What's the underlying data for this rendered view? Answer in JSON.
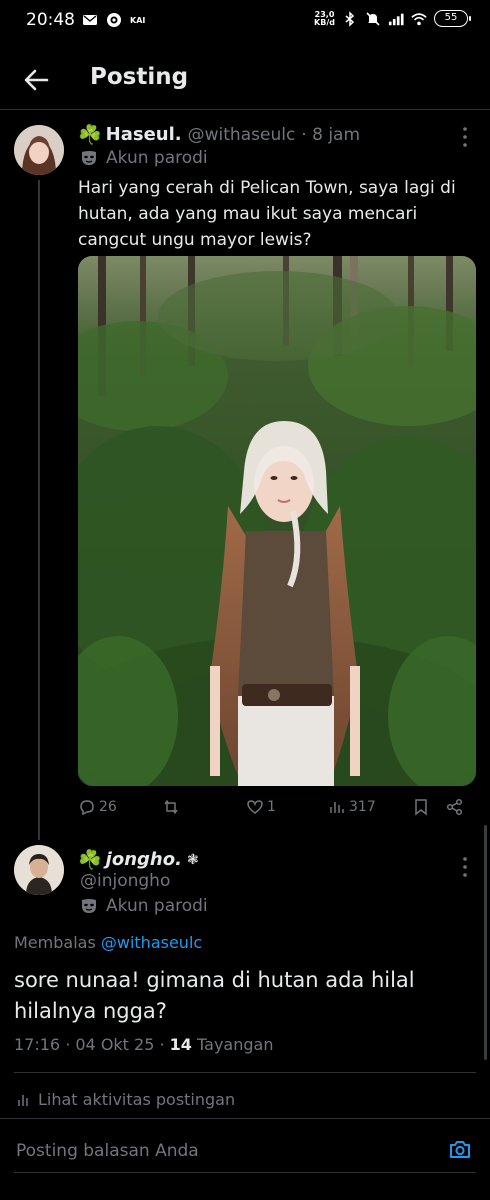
{
  "status_bar": {
    "time": "20:48",
    "kai": "KAI",
    "net_speed_value": "23,0",
    "net_speed_unit": "KB/d",
    "battery": "55",
    "icons": [
      "mail-icon",
      "circle-app-icon",
      "bluetooth-icon",
      "mute-icon",
      "signal-icon",
      "wifi-icon"
    ]
  },
  "header": {
    "title": "Posting",
    "back_icon": "arrow-left-icon"
  },
  "tweet": {
    "badge": "☘️",
    "name": "Haseul.",
    "handle": "@withaseulc",
    "time": "· 8 jam",
    "parody_label": "Akun parodi",
    "text": "Hari yang cerah di Pelican Town, saya lagi di hutan, ada yang mau ikut saya mencari cangcut ungu mayor lewis?",
    "actions": {
      "replies": "26",
      "retweets": "",
      "likes": "1",
      "views": "317"
    }
  },
  "reply": {
    "badge": "☘️",
    "name": "jongho.",
    "name_suffix": "❃",
    "handle": "@injongho",
    "parody_label": "Akun parodi",
    "replying_prefix": "Membalas",
    "replying_to": "@withaseulc",
    "text": "sore nunaa! gimana di hutan ada hilal hilalnya ngga?",
    "timestamp": "17:16 · 04 Okt 25 · ",
    "views_count": "14",
    "views_label": " Tayangan"
  },
  "activity_label": "Lihat aktivitas postingan",
  "reply_box": {
    "placeholder": "Posting balasan Anda"
  },
  "colors": {
    "background": "#000000",
    "accent": "#1d9bf0",
    "muted": "#71767b",
    "text": "#e7e9ea",
    "clover": "#3bb44a"
  }
}
